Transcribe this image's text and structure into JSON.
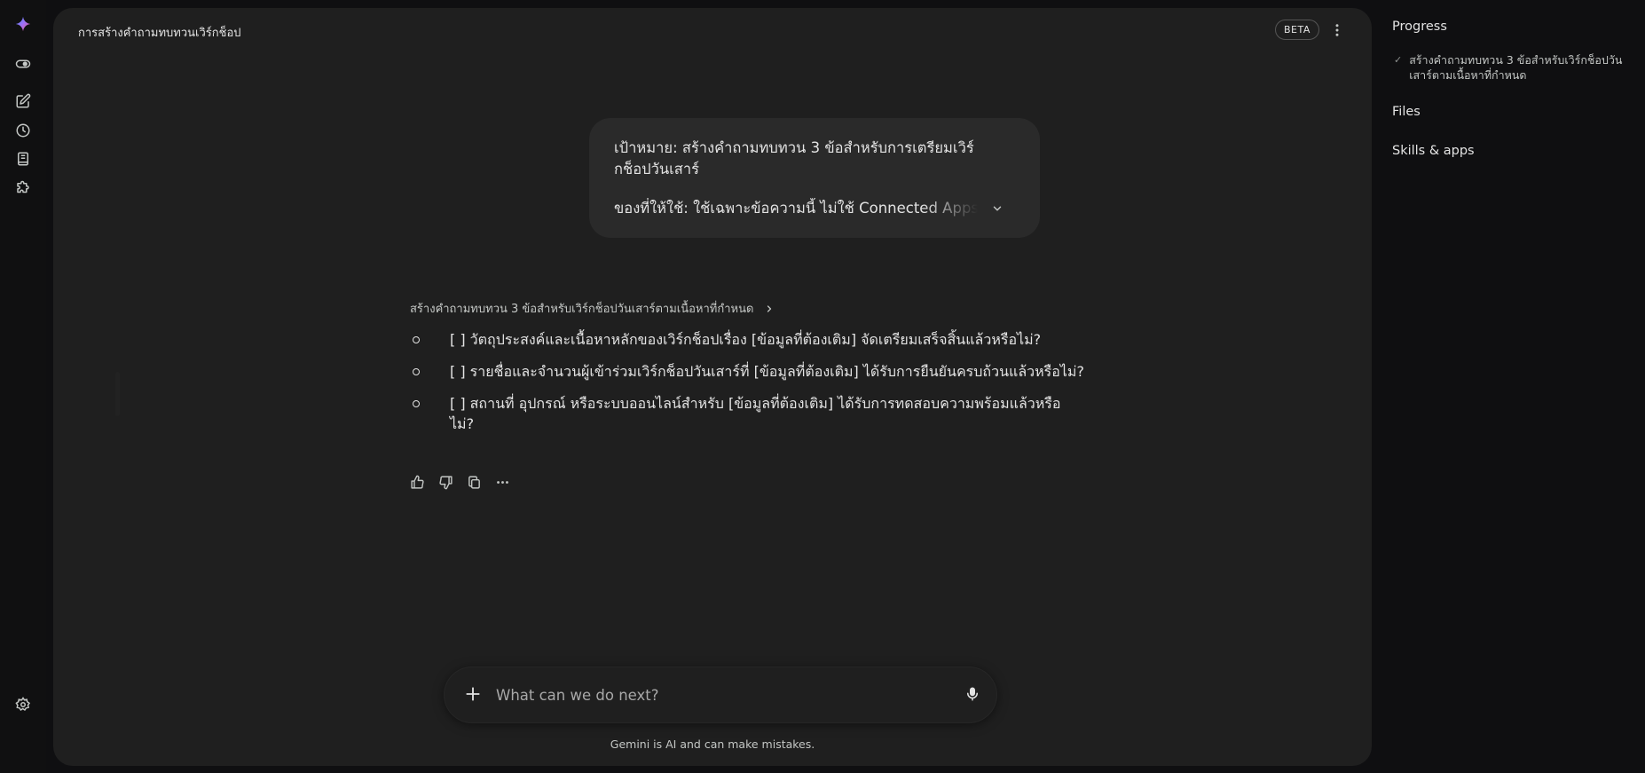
{
  "rail": {
    "icons": [
      "gemini-spark-icon",
      "toggle-icon",
      "new-chat-icon",
      "history-icon",
      "notebook-icon",
      "extensions-icon",
      "settings-icon"
    ]
  },
  "header": {
    "title": "การสร้างคำถามทบทวนเวิร์กช็อป",
    "badge": "BETA"
  },
  "user_message": {
    "goal": "เป้าหมาย: สร้างคำถามทบทวน 3 ข้อสำหรับการเตรียมเวิร์กช็อปวันเสาร์",
    "resources": "ของที่ให้ใช้: ใช้เฉพาะข้อความนี้ ไม่ใช้ Connected Apps ไม่เปิด"
  },
  "response": {
    "step_title": "สร้างคำถามทบทวน 3 ข้อสำหรับเวิร์กช็อปวันเสาร์ตามเนื้อหาที่กำหนด",
    "items": [
      "[ ] วัตถุประสงค์และเนื้อหาหลักของเวิร์กช็อปเรื่อง [ข้อมูลที่ต้องเติม] จัดเตรียมเสร็จสิ้นแล้วหรือไม่?",
      "[ ] รายชื่อและจำนวนผู้เข้าร่วมเวิร์กช็อปวันเสาร์ที่ [ข้อมูลที่ต้องเติม] ได้รับการยืนยันครบถ้วนแล้วหรือไม่?",
      "[ ] สถานที่ อุปกรณ์ หรือระบบออนไลน์สำหรับ [ข้อมูลที่ต้องเติม] ได้รับการทดสอบความพร้อมแล้วหรือไม่?"
    ]
  },
  "composer": {
    "placeholder": "What can we do next?"
  },
  "disclaimer": "Gemini is AI and can make mistakes.",
  "side_panel": {
    "progress_title": "Progress",
    "progress_item": "สร้างคำถามทบทวน 3 ข้อสำหรับเวิร์กช็อปวันเสาร์ตามเนื้อหาที่กำหนด",
    "files_title": "Files",
    "skills_title": "Skills & apps"
  },
  "colors": {
    "page_bg": "#0f0f11",
    "main_bg": "#1f1f1f",
    "bubble_bg": "#2a2a2a",
    "text": "#e3e3e3",
    "muted": "#c4c7c5"
  }
}
